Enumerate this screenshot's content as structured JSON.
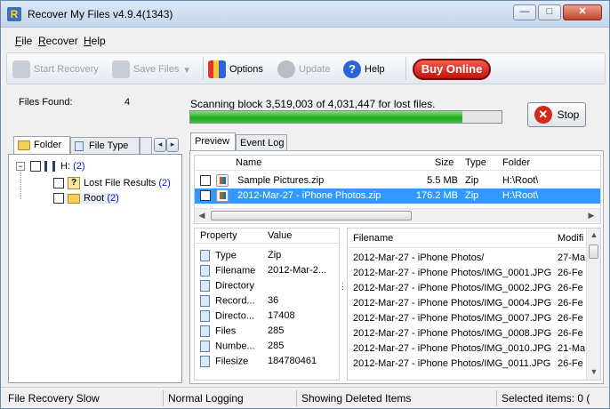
{
  "window": {
    "title": "Recover My Files v4.9.4(1343)",
    "minimize": "—",
    "maximize": "□",
    "close": "✕"
  },
  "menu": [
    {
      "accel": "F",
      "rest": "ile"
    },
    {
      "accel": "R",
      "rest": "ecover"
    },
    {
      "accel": "H",
      "rest": "elp"
    }
  ],
  "toolbar": {
    "start_recovery": "Start Recovery",
    "save_files": "Save Files",
    "save_dropdown": "▾",
    "options": "Options",
    "update": "Update",
    "help": "Help",
    "buy_online": "Buy Online"
  },
  "scan": {
    "files_found_label": "Files Found:",
    "files_found_count": "4",
    "message": "Scanning block 3,519,003 of 4,031,447 for lost files.",
    "progress": 0.873,
    "stop_label": "Stop"
  },
  "left_tabs": {
    "folder": "Folder",
    "file_type": "File Type",
    "prev": "◂",
    "next": "▸"
  },
  "tree": {
    "drive": {
      "label": "H:",
      "count": "(2)",
      "expander": "−"
    },
    "items": [
      {
        "label": "Lost File Results",
        "count": "(2)"
      },
      {
        "label": "Root",
        "count": "(2)"
      }
    ]
  },
  "right_tabs": {
    "preview": "Preview",
    "event_log": "Event Log"
  },
  "files_table": {
    "columns": [
      "Name",
      "Size",
      "Type",
      "Folder"
    ],
    "rows": [
      {
        "name": "Sample Pictures.zip",
        "size": "5.5 MB",
        "type": "Zip",
        "folder": "H:\\Root\\"
      },
      {
        "name": "2012-Mar-27 - iPhone Photos.zip",
        "size": "176.2 MB",
        "type": "Zip",
        "folder": "H:\\Root\\"
      }
    ]
  },
  "properties": {
    "columns": [
      "Property",
      "Value"
    ],
    "rows": [
      {
        "property": "Type",
        "value": "Zip"
      },
      {
        "property": "Filename",
        "value": "2012-Mar-2..."
      },
      {
        "property": "Directory",
        "value": ""
      },
      {
        "property": "Record...",
        "value": "36"
      },
      {
        "property": "Directo...",
        "value": "17408"
      },
      {
        "property": "Files",
        "value": "285"
      },
      {
        "property": "Numbe...",
        "value": "285"
      },
      {
        "property": "Filesize",
        "value": "184780461"
      }
    ]
  },
  "archive": {
    "columns": [
      "Filename",
      "Modifi"
    ],
    "rows": [
      {
        "filename": "2012-Mar-27 - iPhone Photos/",
        "modified": "27-Ma"
      },
      {
        "filename": "2012-Mar-27 - iPhone Photos/IMG_0001.JPG",
        "modified": "26-Fe"
      },
      {
        "filename": "2012-Mar-27 - iPhone Photos/IMG_0002.JPG",
        "modified": "26-Fe"
      },
      {
        "filename": "2012-Mar-27 - iPhone Photos/IMG_0004.JPG",
        "modified": "26-Fe"
      },
      {
        "filename": "2012-Mar-27 - iPhone Photos/IMG_0007.JPG",
        "modified": "26-Fe"
      },
      {
        "filename": "2012-Mar-27 - iPhone Photos/IMG_0008.JPG",
        "modified": "26-Fe"
      },
      {
        "filename": "2012-Mar-27 - iPhone Photos/IMG_0010.JPG",
        "modified": "21-Ma"
      },
      {
        "filename": "2012-Mar-27 - iPhone Photos/IMG_0011.JPG",
        "modified": "26-Fe"
      }
    ]
  },
  "statusbar": {
    "mode": "File Recovery Slow",
    "logging": "Normal Logging",
    "showing": "Showing Deleted Items",
    "selected": "Selected items: 0 ("
  },
  "colors": {
    "selection": "#3399ff",
    "progress": "#1fa71f",
    "buy": "#c0140c",
    "tree_count": "#0018d8"
  }
}
